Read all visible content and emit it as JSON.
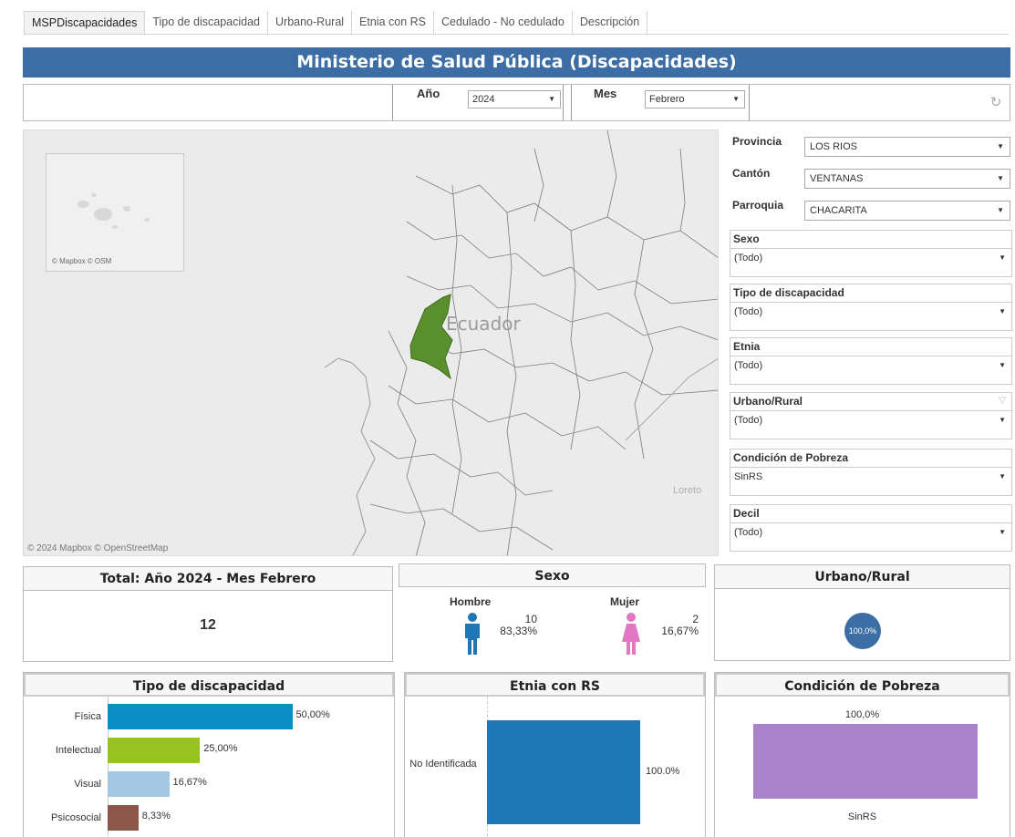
{
  "tabs": [
    {
      "label": "MSPDiscapacidades",
      "active": true
    },
    {
      "label": "Tipo de discapacidad",
      "active": false
    },
    {
      "label": "Urbano-Rural",
      "active": false
    },
    {
      "label": "Etnia con RS",
      "active": false
    },
    {
      "label": "Cedulado - No cedulado",
      "active": false
    },
    {
      "label": "Descripción",
      "active": false
    }
  ],
  "header": {
    "title": "Ministerio de Salud Pública (Discapacidades)"
  },
  "filters_top": {
    "year_label": "Año",
    "year_value": "2024",
    "month_label": "Mes",
    "month_value": "Febrero",
    "refresh_icon": "refresh-icon"
  },
  "map": {
    "inset_attribution": "© Mapbox  © OSM",
    "country_label": "Ecuador",
    "region_label": "Loreto",
    "attribution": "© 2024 Mapbox © OpenStreetMap",
    "highlight_color": "#5a8f2d"
  },
  "right_filters": {
    "provincia": {
      "label": "Provincia",
      "value": "LOS RIOS"
    },
    "canton": {
      "label": "Cantón",
      "value": "VENTANAS"
    },
    "parroquia": {
      "label": "Parroquia",
      "value": "CHACARITA"
    },
    "sexo": {
      "label": "Sexo",
      "value": "(Todo)"
    },
    "tipo": {
      "label": "Tipo de discapacidad",
      "value": "(Todo)"
    },
    "etnia": {
      "label": "Etnia",
      "value": "(Todo)"
    },
    "urbano": {
      "label": "Urbano/Rural",
      "value": "(Todo)"
    },
    "pobreza": {
      "label": "Condición de Pobreza",
      "value": "SinRS"
    },
    "decil": {
      "label": "Decil",
      "value": "(Todo)"
    }
  },
  "total": {
    "title": "Total: Año 2024 - Mes Febrero",
    "value": "12"
  },
  "sexo": {
    "title": "Sexo",
    "hombre": {
      "label": "Hombre",
      "count": "10",
      "pct": "83,33%",
      "color": "#1f77b4"
    },
    "mujer": {
      "label": "Mujer",
      "count": "2",
      "pct": "16,67%",
      "color": "#e377c2"
    }
  },
  "urbano_rural": {
    "title": "Urbano/Rural",
    "value": "100,0%",
    "color": "#3c6ea5"
  },
  "chart_data": [
    {
      "type": "bar",
      "title": "Tipo de discapacidad",
      "orientation": "horizontal",
      "categories": [
        "Física",
        "Intelectual",
        "Visual",
        "Psicosocial"
      ],
      "values": [
        50.0,
        25.0,
        16.67,
        8.33
      ],
      "labels": [
        "50,00%",
        "25,00%",
        "16,67%",
        "8,33%"
      ],
      "colors": [
        "#0b8ec4",
        "#98c21f",
        "#a4c8e1",
        "#8c564b"
      ],
      "xlim": [
        0,
        60
      ]
    },
    {
      "type": "bar",
      "title": "Etnia con RS",
      "orientation": "horizontal",
      "categories": [
        "No Identificada"
      ],
      "values": [
        100.0
      ],
      "labels": [
        "100.0%"
      ],
      "colors": [
        "#1f77b4"
      ]
    },
    {
      "type": "bar",
      "title": "Condición de Pobreza",
      "orientation": "vertical",
      "categories": [
        "SinRS"
      ],
      "values": [
        100.0
      ],
      "labels": [
        "100,0%"
      ],
      "colors": [
        "#a883c9"
      ]
    }
  ]
}
